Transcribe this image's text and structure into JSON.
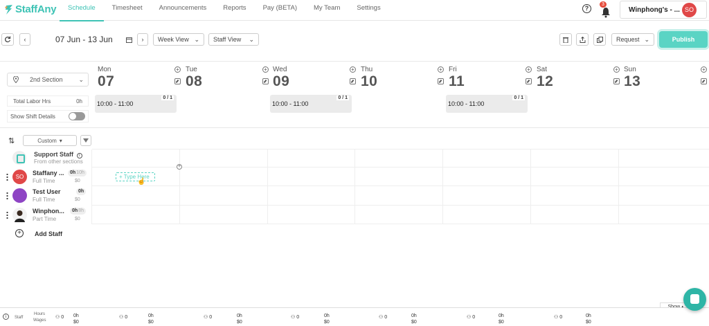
{
  "brand": {
    "name": "StaffAny"
  },
  "nav": {
    "items": [
      {
        "label": "Schedule",
        "active": true
      },
      {
        "label": "Timesheet"
      },
      {
        "label": "Announcements"
      },
      {
        "label": "Reports"
      },
      {
        "label": "Pay (BETA)"
      },
      {
        "label": "My Team"
      },
      {
        "label": "Settings"
      }
    ],
    "notifications_count": "3",
    "account_name": "Winphong's - ...",
    "account_initials": "SO"
  },
  "toolbar": {
    "date_range": "07 Jun - 13 Jun",
    "view_select": "Week View",
    "staff_view_select": "Staff View",
    "request_select": "Request",
    "publish_label": "Publish"
  },
  "filters": {
    "section": "2nd Section",
    "labor_label": "Total Labor Hrs",
    "labor_value": "0h",
    "shift_details_label": "Show Shift Details",
    "sort_select": "Custom"
  },
  "days": [
    {
      "name": "Mon",
      "num": "07",
      "shift": {
        "count": "0 / 1",
        "time": "10:00 - 11:00"
      }
    },
    {
      "name": "Tue",
      "num": "08"
    },
    {
      "name": "Wed",
      "num": "09",
      "shift": {
        "count": "0 / 1",
        "time": "10:00 - 11:00"
      }
    },
    {
      "name": "Thu",
      "num": "10"
    },
    {
      "name": "Fri",
      "num": "11",
      "shift": {
        "count": "0 / 1",
        "time": "10:00 - 11:00"
      }
    },
    {
      "name": "Sat",
      "num": "12"
    },
    {
      "name": "Sun",
      "num": "13"
    }
  ],
  "support": {
    "title": "Support Staff",
    "subtitle": "From other sections"
  },
  "staff": [
    {
      "name": "Staffany ...",
      "role": "Full Time",
      "hours": "0h",
      "hours_sub": "10h",
      "wage": "$0",
      "initials": "SO",
      "color": "#e04848"
    },
    {
      "name": "Test User",
      "role": "Full Time",
      "hours": "0h",
      "hours_sub": "",
      "wage": "$0",
      "initials": "",
      "color": "#8e44c4"
    },
    {
      "name": "Winphon...",
      "role": "Part Time",
      "hours": "0h",
      "hours_sub": "8h",
      "wage": "$0",
      "initials": "",
      "color": "#444444"
    }
  ],
  "type_here": "+ Type Here",
  "add_staff": "Add Staff",
  "footer": {
    "show_label": "Show",
    "staff_label": "Staff",
    "hours_label": "Hours",
    "wages_label": "Wages",
    "cols": [
      {
        "staff": "0",
        "hours": "0h",
        "wages": "$0"
      },
      {
        "staff": "0",
        "hours": "0h",
        "wages": "$0"
      },
      {
        "staff": "0",
        "hours": "0h",
        "wages": "$0"
      },
      {
        "staff": "0",
        "hours": "0h",
        "wages": "$0"
      },
      {
        "staff": "0",
        "hours": "0h",
        "wages": "$0"
      },
      {
        "staff": "0",
        "hours": "0h",
        "wages": "$0"
      },
      {
        "staff": "0",
        "hours": "0h",
        "wages": "$0"
      }
    ]
  },
  "colors": {
    "accent": "#3ec3b5",
    "publish": "#5ad4c4"
  }
}
